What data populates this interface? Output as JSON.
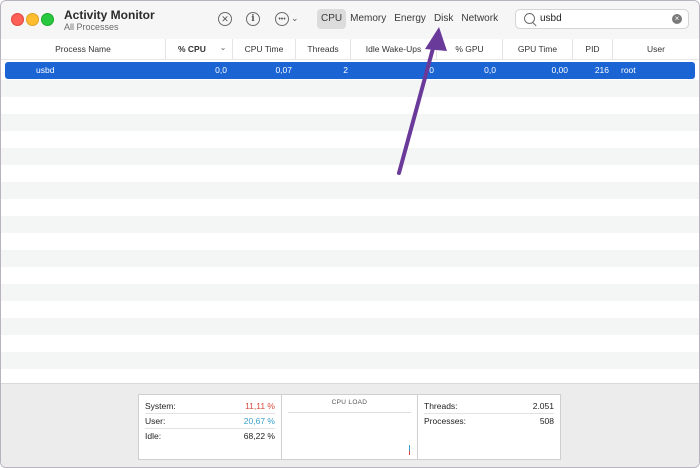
{
  "app": {
    "title": "Activity Monitor",
    "subtitle": "All Processes"
  },
  "toolbar": {
    "stop_icon": "stop-process-icon",
    "info_icon": "info-icon",
    "more_icon": "more-icon",
    "tabs": [
      "CPU",
      "Memory",
      "Energy",
      "Disk",
      "Network"
    ],
    "active_tab": "CPU"
  },
  "search": {
    "value": "usbd"
  },
  "table": {
    "columns": [
      "Process Name",
      "% CPU",
      "CPU Time",
      "Threads",
      "Idle Wake-Ups",
      "% GPU",
      "GPU Time",
      "PID",
      "User"
    ],
    "sorted_column": "% CPU",
    "rows": [
      {
        "name": "usbd",
        "cpu": "0,0",
        "cpu_time": "0,07",
        "threads": "2",
        "idle_wakeups": "0",
        "gpu": "0,0",
        "gpu_time": "0,00",
        "pid": "216",
        "user": "root"
      }
    ]
  },
  "footer": {
    "system_label": "System:",
    "system_value": "11,11 %",
    "user_label": "User:",
    "user_value": "20,67 %",
    "idle_label": "Idle:",
    "idle_value": "68,22 %",
    "cpu_load_label": "CPU LOAD",
    "threads_label": "Threads:",
    "threads_value": "2.051",
    "processes_label": "Processes:",
    "processes_value": "508"
  },
  "colors": {
    "selection": "#1a64d4",
    "system_value": "#d64a3b",
    "user_value": "#3aa0c8",
    "annotation_arrow": "#6a3a9a"
  }
}
